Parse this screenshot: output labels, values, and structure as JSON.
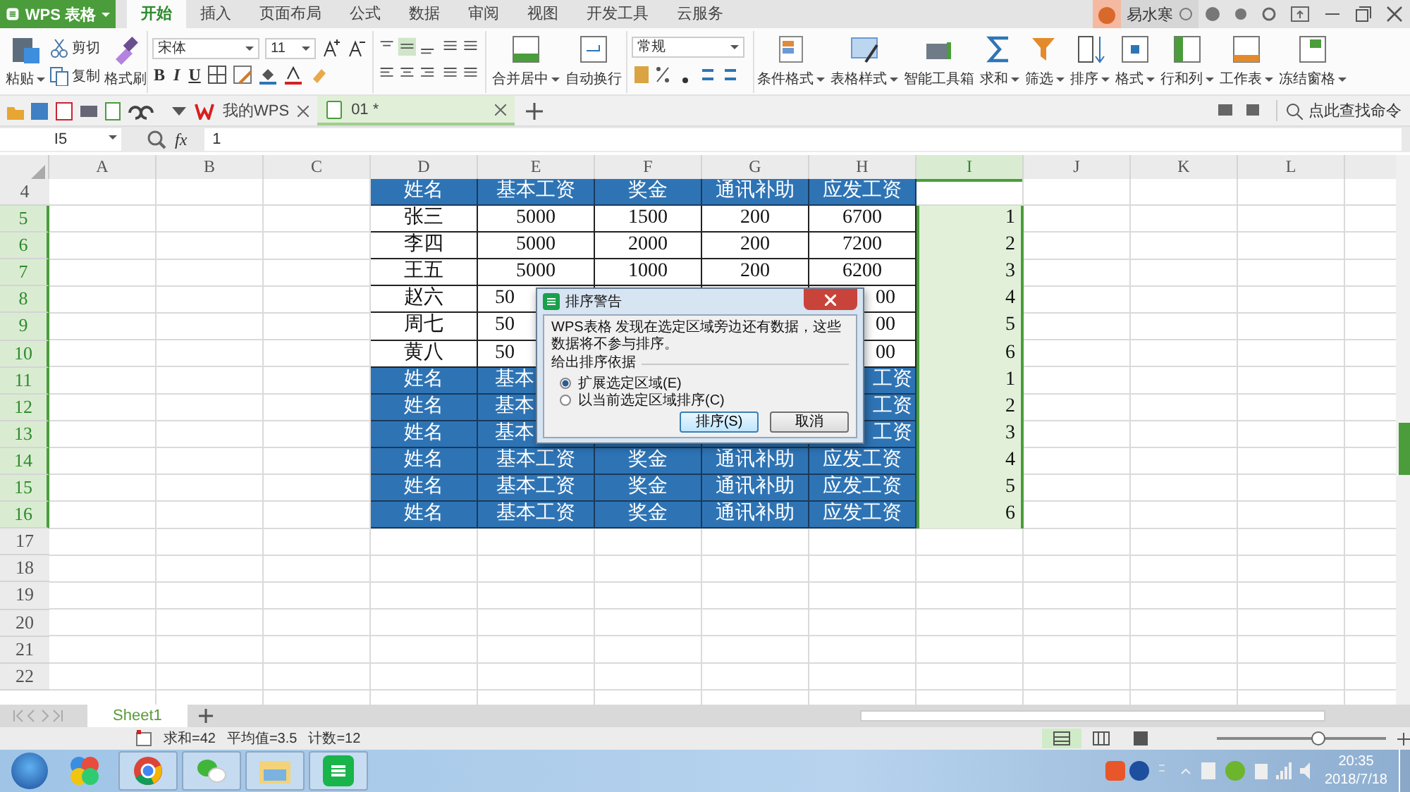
{
  "app": {
    "name": "WPS 表格"
  },
  "menu_tabs": [
    {
      "label": "开始",
      "selected": true
    },
    {
      "label": "插入",
      "selected": false
    },
    {
      "label": "页面布局",
      "selected": false
    },
    {
      "label": "公式",
      "selected": false
    },
    {
      "label": "数据",
      "selected": false
    },
    {
      "label": "审阅",
      "selected": false
    },
    {
      "label": "视图",
      "selected": false
    },
    {
      "label": "开发工具",
      "selected": false
    },
    {
      "label": "云服务",
      "selected": false
    }
  ],
  "user": {
    "name": "易水寒"
  },
  "ribbon": {
    "paste": "粘贴",
    "cut": "剪切",
    "copy": "复制",
    "format_painter": "格式刷",
    "font": "宋体",
    "font_size": "11",
    "font_styles": [
      "B",
      "I",
      "U"
    ],
    "merge": "合并居中",
    "wrap": "自动换行",
    "number_format": "常规",
    "buttons": [
      {
        "label": "条件格式",
        "dropdown": true,
        "kind": "cond"
      },
      {
        "label": "表格样式",
        "dropdown": true,
        "kind": "style"
      },
      {
        "label": "智能工具箱",
        "dropdown": false,
        "kind": "tools"
      },
      {
        "label": "求和",
        "dropdown": true,
        "kind": "sum"
      },
      {
        "label": "筛选",
        "dropdown": true,
        "kind": "filter"
      },
      {
        "label": "排序",
        "dropdown": true,
        "kind": "sort"
      },
      {
        "label": "格式",
        "dropdown": true,
        "kind": "format"
      },
      {
        "label": "行和列",
        "dropdown": true,
        "kind": "rowcol"
      },
      {
        "label": "工作表",
        "dropdown": true,
        "kind": "sheet"
      },
      {
        "label": "冻结窗格",
        "dropdown": true,
        "kind": "freeze"
      }
    ]
  },
  "doc_tabs": [
    {
      "label": "我的WPS",
      "selected": false
    },
    {
      "label": "01 *",
      "selected": true
    }
  ],
  "command_search": {
    "placeholder": "点此查找命令"
  },
  "formula_bar": {
    "cell": "I5",
    "fx": "fx",
    "value": "1"
  },
  "sheet": {
    "columns": [
      {
        "label": "A",
        "selected": false
      },
      {
        "label": "B",
        "selected": false
      },
      {
        "label": "C",
        "selected": false
      },
      {
        "label": "D",
        "selected": false
      },
      {
        "label": "E",
        "selected": false
      },
      {
        "label": "F",
        "selected": false
      },
      {
        "label": "G",
        "selected": false
      },
      {
        "label": "H",
        "selected": false
      },
      {
        "label": "I",
        "selected": true
      },
      {
        "label": "J",
        "selected": false
      },
      {
        "label": "K",
        "selected": false
      },
      {
        "label": "L",
        "selected": false
      }
    ],
    "rows": [
      {
        "num": "4",
        "selected": false,
        "kind": "header",
        "cells": [
          "",
          "",
          "",
          "姓名",
          "基本工资",
          "奖金",
          "通讯补助",
          "应发工资",
          ""
        ]
      },
      {
        "num": "5",
        "selected": true,
        "kind": "data",
        "cells": [
          "",
          "",
          "",
          "张三",
          "5000",
          "1500",
          "200",
          "6700",
          "1"
        ]
      },
      {
        "num": "6",
        "selected": true,
        "kind": "data",
        "cells": [
          "",
          "",
          "",
          "李四",
          "5000",
          "2000",
          "200",
          "7200",
          "2"
        ]
      },
      {
        "num": "7",
        "selected": true,
        "kind": "data",
        "cells": [
          "",
          "",
          "",
          "王五",
          "5000",
          "1000",
          "200",
          "6200",
          "3"
        ]
      },
      {
        "num": "8",
        "selected": true,
        "kind": "data",
        "cells": [
          "",
          "",
          "",
          "赵六",
          "50",
          null,
          null,
          "00",
          "4"
        ]
      },
      {
        "num": "9",
        "selected": true,
        "kind": "data",
        "cells": [
          "",
          "",
          "",
          "周七",
          "50",
          null,
          null,
          "00",
          "5"
        ]
      },
      {
        "num": "10",
        "selected": true,
        "kind": "data",
        "cells": [
          "",
          "",
          "",
          "黄八",
          "50",
          null,
          null,
          "00",
          "6"
        ]
      },
      {
        "num": "11",
        "selected": true,
        "kind": "header",
        "cells": [
          "",
          "",
          "",
          "姓名",
          "基本",
          null,
          null,
          "工资",
          "1"
        ]
      },
      {
        "num": "12",
        "selected": true,
        "kind": "header",
        "cells": [
          "",
          "",
          "",
          "姓名",
          "基本",
          null,
          null,
          "工资",
          "2"
        ]
      },
      {
        "num": "13",
        "selected": true,
        "kind": "header",
        "cells": [
          "",
          "",
          "",
          "姓名",
          "基本",
          null,
          null,
          "工资",
          "3"
        ]
      },
      {
        "num": "14",
        "selected": true,
        "kind": "header",
        "cells": [
          "",
          "",
          "",
          "姓名",
          "基本工资",
          "奖金",
          "通讯补助",
          "应发工资",
          "4"
        ]
      },
      {
        "num": "15",
        "selected": true,
        "kind": "header",
        "cells": [
          "",
          "",
          "",
          "姓名",
          "基本工资",
          "奖金",
          "通讯补助",
          "应发工资",
          "5"
        ]
      },
      {
        "num": "16",
        "selected": true,
        "kind": "header",
        "cells": [
          "",
          "",
          "",
          "姓名",
          "基本工资",
          "奖金",
          "通讯补助",
          "应发工资",
          "6"
        ]
      },
      {
        "num": "17",
        "selected": false,
        "kind": "empty",
        "cells": []
      },
      {
        "num": "18",
        "selected": false,
        "kind": "empty",
        "cells": []
      },
      {
        "num": "19",
        "selected": false,
        "kind": "empty",
        "cells": []
      },
      {
        "num": "20",
        "selected": false,
        "kind": "empty",
        "cells": []
      },
      {
        "num": "21",
        "selected": false,
        "kind": "empty",
        "cells": []
      },
      {
        "num": "22",
        "selected": false,
        "kind": "empty",
        "cells": []
      }
    ]
  },
  "dialog": {
    "title": "排序警告",
    "message": "WPS表格 发现在选定区域旁边还有数据，这些数据将不参与排序。",
    "group": "给出排序依据",
    "options": [
      {
        "label": "扩展选定区域(E)",
        "selected": true
      },
      {
        "label": "以当前选定区域排序(C)",
        "selected": false
      }
    ],
    "buttons": [
      "排序(S)",
      "取消"
    ]
  },
  "sheet_tabs": [
    {
      "label": "Sheet1",
      "selected": true
    }
  ],
  "status_bar": [
    "求和=42",
    "平均值=3.5",
    "计数=12"
  ],
  "zoom_slider": {
    "level": 0.6
  },
  "taskbar": {
    "time": "20:35",
    "date": "2018/7/18"
  }
}
